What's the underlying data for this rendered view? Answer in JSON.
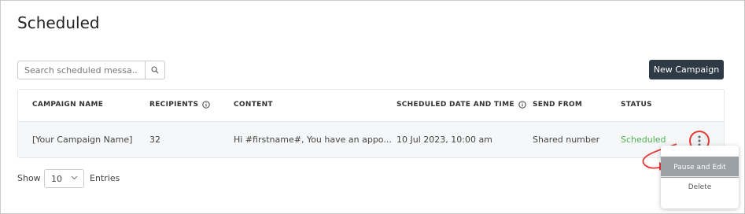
{
  "page": {
    "title": "Scheduled"
  },
  "search": {
    "placeholder": "Search scheduled messa..."
  },
  "toolbar": {
    "new_campaign_label": "New Campaign"
  },
  "table": {
    "headers": {
      "campaign_name": "CAMPAIGN NAME",
      "recipients": "RECIPIENTS",
      "content": "CONTENT",
      "scheduled": "SCHEDULED DATE AND TIME",
      "send_from": "SEND FROM",
      "status": "STATUS"
    },
    "rows": [
      {
        "campaign_name": "[Your Campaign Name]",
        "recipients": "32",
        "content": "Hi #firstname#, You have an appo...",
        "scheduled": "10 Jul 2023, 10:00 am",
        "send_from": "Shared number",
        "status": "Scheduled"
      }
    ]
  },
  "pagination": {
    "show_label": "Show",
    "entries_value": "10",
    "entries_label": "Entries"
  },
  "menu": {
    "pause_edit": "Pause and Edit",
    "delete": "Delete"
  },
  "colors": {
    "status_scheduled": "#4caf50",
    "primary_button": "#2e3a46",
    "highlight": "#e53935"
  }
}
